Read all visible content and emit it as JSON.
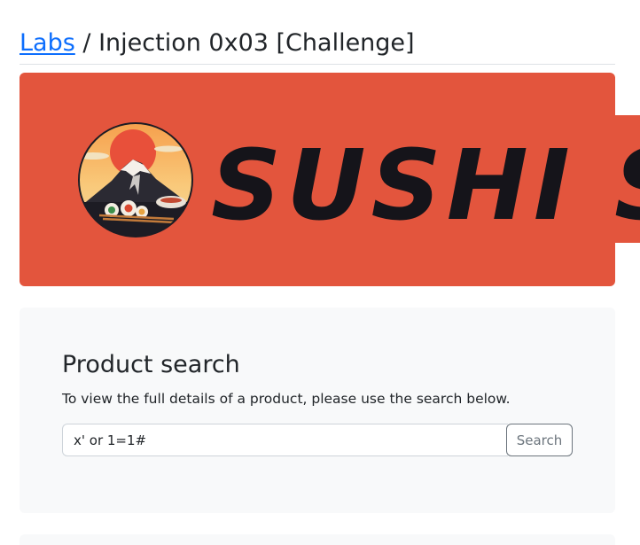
{
  "header": {
    "breadcrumb_link": "Labs",
    "separator": "/",
    "page_title": "Injection 0x03 [Challenge]"
  },
  "banner": {
    "brand_text": "SUSHI SUPER",
    "background_color": "#e3553d",
    "logo_icon": "sushi-mount-fuji-logo"
  },
  "search": {
    "heading": "Product search",
    "description": "To view the full details of a product, please use the search below.",
    "input_value": "x' or 1=1#",
    "button_label": "Search"
  },
  "colors": {
    "link": "#0d6efd",
    "card_bg": "#f8f9fa",
    "button_border": "#6c757d"
  }
}
